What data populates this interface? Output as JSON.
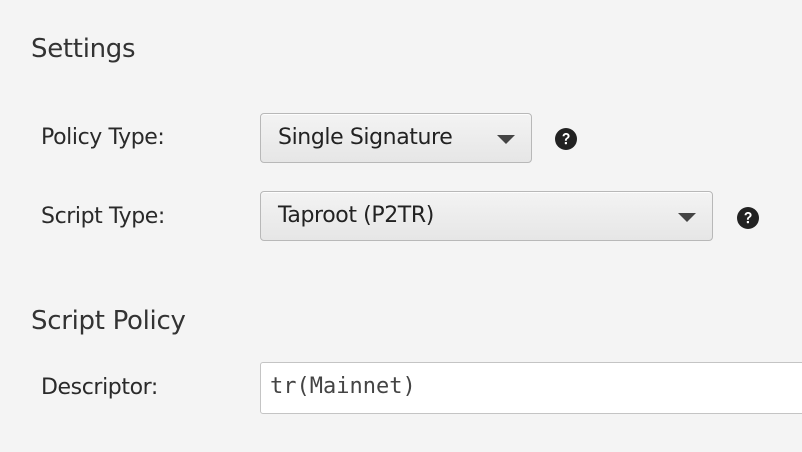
{
  "settings": {
    "title": "Settings",
    "policy_type": {
      "label": "Policy Type:",
      "value": "Single Signature"
    },
    "script_type": {
      "label": "Script Type:",
      "value": "Taproot (P2TR)"
    },
    "help_icon": "question-circle-icon"
  },
  "script_policy": {
    "title": "Script Policy",
    "descriptor": {
      "label": "Descriptor:",
      "value": "tr(Mainnet)"
    }
  }
}
